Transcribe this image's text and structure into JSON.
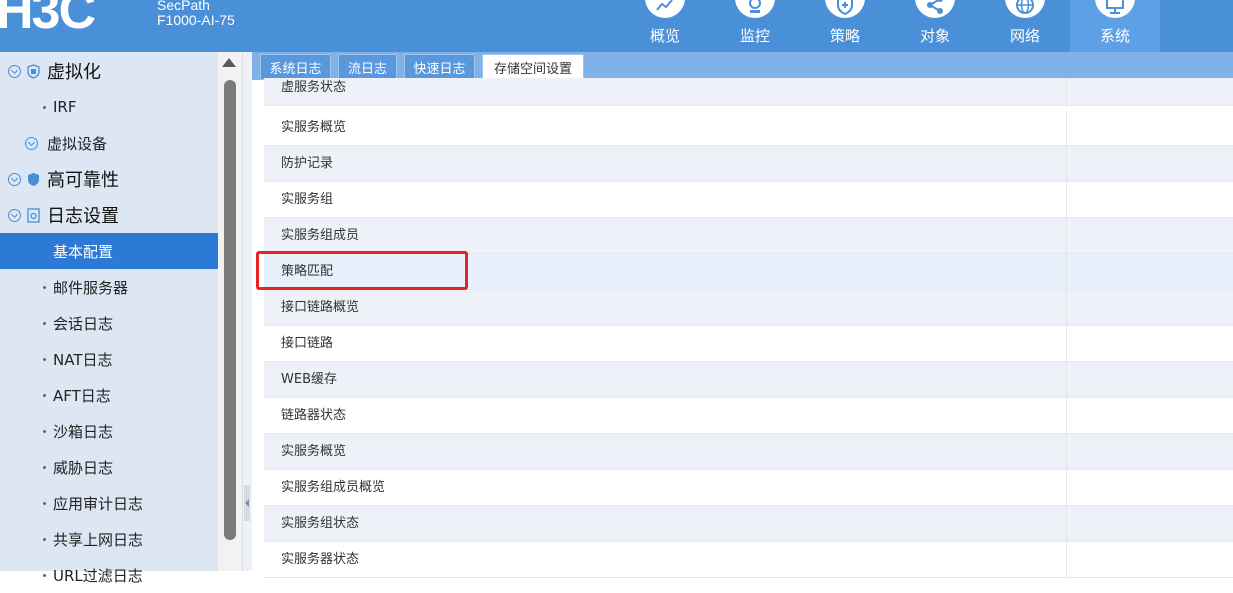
{
  "header": {
    "product_line1": "SecPath",
    "product_line2": "F1000-AI-75",
    "nav": [
      {
        "label": "概览",
        "icon": "overview-icon"
      },
      {
        "label": "监控",
        "icon": "monitor-icon"
      },
      {
        "label": "策略",
        "icon": "policy-shield-icon"
      },
      {
        "label": "对象",
        "icon": "object-share-icon"
      },
      {
        "label": "网络",
        "icon": "network-globe-icon"
      },
      {
        "label": "系统",
        "icon": "system-desktop-icon"
      }
    ],
    "active_nav": "系统"
  },
  "sidebar": {
    "items": [
      {
        "label": "虚拟化",
        "level": 1
      },
      {
        "label": "IRF",
        "level": 3
      },
      {
        "label": "虚拟设备",
        "level": 2
      },
      {
        "label": "高可靠性",
        "level": 1
      },
      {
        "label": "日志设置",
        "level": 1
      },
      {
        "label": "基本配置",
        "level": 3,
        "selected": true
      },
      {
        "label": "邮件服务器",
        "level": 3
      },
      {
        "label": "会话日志",
        "level": 3
      },
      {
        "label": "NAT日志",
        "level": 3
      },
      {
        "label": "AFT日志",
        "level": 3
      },
      {
        "label": "沙箱日志",
        "level": 3
      },
      {
        "label": "威胁日志",
        "level": 3
      },
      {
        "label": "应用审计日志",
        "level": 3
      },
      {
        "label": "共享上网日志",
        "level": 3
      },
      {
        "label": "URL过滤日志",
        "level": 3
      }
    ]
  },
  "tabs": [
    {
      "label": "系统日志"
    },
    {
      "label": "流日志"
    },
    {
      "label": "快速日志"
    },
    {
      "label": "存储空间设置",
      "active": true
    }
  ],
  "table": {
    "rows": [
      "虚服务状态",
      "实服务概览",
      "防护记录",
      "实服务组",
      "实服务组成员",
      "策略匹配",
      "接口链路概览",
      "接口链路",
      "WEB缓存",
      "链路器状态",
      "实服务概览",
      "实服务组成员概览",
      "实服务组状态",
      "实服务器状态"
    ],
    "highlighted_row": "策略匹配"
  },
  "colors": {
    "header_bg": "#4a90d9",
    "sidebar_bg": "#dde6f3",
    "selected_bg": "#2d7ad6",
    "highlight_border": "#e8231c"
  }
}
